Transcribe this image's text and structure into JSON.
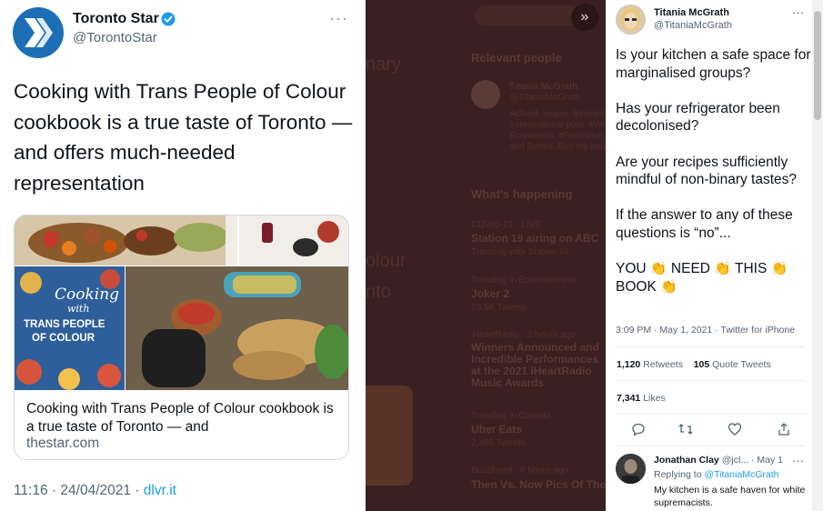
{
  "left_tweet": {
    "author_name": "Toronto Star",
    "author_handle": "@TorontoStar",
    "more_label": "···",
    "text": "Cooking with Trans People of Colour cookbook is a true taste of Toronto — and offers much-needed representation",
    "card": {
      "book_cover_line1": "Cooking",
      "book_cover_line2": "with",
      "book_cover_line3": "TRANS PEOPLE",
      "book_cover_line4": "OF COLOUR",
      "title": "Cooking with Trans People of Colour cookbook is a true taste of Toronto — and",
      "domain": "thestar.com"
    },
    "time": "11:16 · 24/04/2021 · ",
    "source": "dlvr.it"
  },
  "middle": {
    "partial_word_1": "nary",
    "section_relevant": "Relevant people",
    "relevant_name": "Titania McGrath",
    "relevant_handle": "@TitaniaMcGrath",
    "relevant_bio": [
      "Activist, vegan, feminist.",
      "Intersectional poet. #Woke",
      "Economics. #Feminism #A",
      "and Series. Buy my book."
    ],
    "partial_word_2": "olour",
    "partial_word_3": "nto",
    "section_happening": "What's happening",
    "trends": [
      {
        "meta": "COVID-19 · LIVE",
        "title": "Station 19 airing on ABC",
        "sub": "Trending with Station 19"
      },
      {
        "meta": "Trending in Entertainment",
        "title": "Joker 2",
        "sub": "10.5K Tweets"
      },
      {
        "meta": "iHeartRadio · 2 hours ago",
        "title": "Winners Announced and Incredible Performances at the 2021 iHeartRadio Music Awards",
        "sub": ""
      },
      {
        "meta": "Trending in Canada",
        "title": "Uber Eats",
        "sub": "2,406 Tweets"
      },
      {
        "meta": "BuzzFeed · 8 hours ago",
        "title": "Then Vs. Now Pics Of The",
        "sub": ""
      }
    ]
  },
  "right_tweet": {
    "author_name": "Titania McGrath",
    "author_handle": "@TitaniaMcGrath",
    "more_label": "···",
    "paragraphs": [
      "Is your kitchen a safe space for marginalised groups?",
      "Has your refrigerator been decolonised?",
      "Are your recipes sufficiently mindful of non-binary tastes?",
      "If the answer to any of these questions is “no”..."
    ],
    "cta_words": [
      "YOU",
      "NEED",
      "THIS",
      "BOOK"
    ],
    "clap_icon": "clapping-hands-icon",
    "meta": "3:09 PM · May 1, 2021 · Twitter for iPhone",
    "retweets_count": "1,120",
    "retweets_label": "Retweets",
    "quotes_count": "105",
    "quotes_label": "Quote Tweets",
    "likes_count": "7,341",
    "likes_label": "Likes",
    "actions": [
      "reply-icon",
      "retweet-icon",
      "like-icon",
      "share-icon"
    ]
  },
  "reply": {
    "author_name": "Jonathan Clay",
    "author_handle_time": "@jcl... · May 1",
    "more_label": "···",
    "replying_prefix": "Replying to ",
    "replying_handle": "@TitaniaMcGrath",
    "text": "My kitchen is a safe haven for white supremacists."
  },
  "colors": {
    "link_blue": "#1d9bf0",
    "verified_blue": "#1d9bf0",
    "star_blue": "#1c6fb5",
    "dim_overlay": "#3a2020"
  }
}
